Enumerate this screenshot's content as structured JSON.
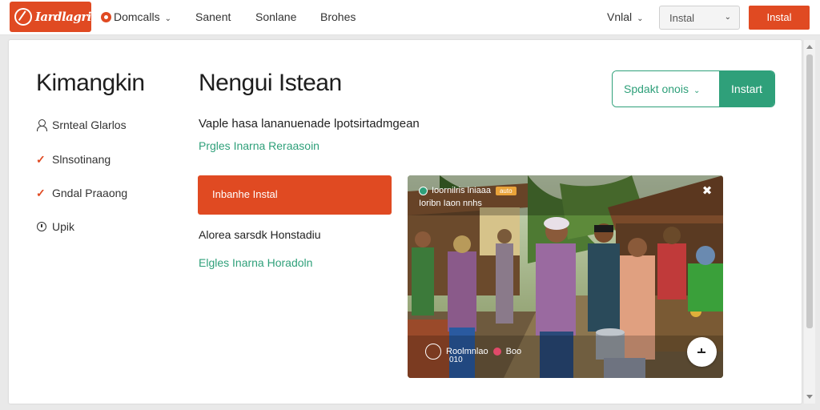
{
  "topbar": {
    "logo_text": "Iardlagri",
    "nav": [
      {
        "label": "Domcalls"
      },
      {
        "label": "Sanent"
      },
      {
        "label": "Sonlane"
      },
      {
        "label": "Brohes"
      }
    ],
    "lang_label": "Vnlal",
    "select_value": "Instal",
    "install_label": "Instal"
  },
  "sidebar": {
    "title": "Kimangkin",
    "items": [
      {
        "label": "Srnteal Glarlos",
        "icon": "user-icon"
      },
      {
        "label": "Slnsotinang",
        "icon": "check-icon"
      },
      {
        "label": "Gndal Praaong",
        "icon": "check-icon"
      },
      {
        "label": "Upik",
        "icon": "clock-icon"
      }
    ]
  },
  "main": {
    "title": "Nengui Istean",
    "description": "Vaple hasa lananuenade lpotsirtadmgean",
    "link1": "Prgles Inarna Reraasoin",
    "primary_button": "Inbanhe Instal",
    "sub_text": "Alorea sarsdk Honstadiu",
    "link2": "Elgles Inarna Horadoln"
  },
  "split_button": {
    "select_label": "Spdakt onois",
    "install_label": "Instart"
  },
  "video": {
    "title": "Ioornilris lniaaa",
    "badge": "auto",
    "subtitle": "Ioribn Iaon nnhs",
    "caption": "Roolmnlao",
    "caption_suffix": "Boo",
    "time": "010",
    "close_icon": "collapse-icon",
    "play_icon": "play-icon"
  },
  "colors": {
    "accent": "#e04a22",
    "green": "#2fa07a"
  }
}
